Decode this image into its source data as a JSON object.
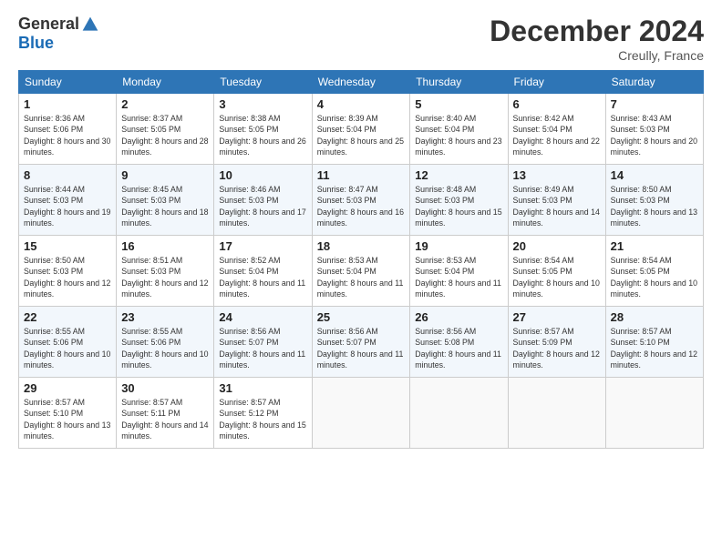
{
  "logo": {
    "general": "General",
    "blue": "Blue"
  },
  "title": "December 2024",
  "location": "Creully, France",
  "weekdays": [
    "Sunday",
    "Monday",
    "Tuesday",
    "Wednesday",
    "Thursday",
    "Friday",
    "Saturday"
  ],
  "weeks": [
    [
      {
        "day": "1",
        "sunrise": "Sunrise: 8:36 AM",
        "sunset": "Sunset: 5:06 PM",
        "daylight": "Daylight: 8 hours and 30 minutes."
      },
      {
        "day": "2",
        "sunrise": "Sunrise: 8:37 AM",
        "sunset": "Sunset: 5:05 PM",
        "daylight": "Daylight: 8 hours and 28 minutes."
      },
      {
        "day": "3",
        "sunrise": "Sunrise: 8:38 AM",
        "sunset": "Sunset: 5:05 PM",
        "daylight": "Daylight: 8 hours and 26 minutes."
      },
      {
        "day": "4",
        "sunrise": "Sunrise: 8:39 AM",
        "sunset": "Sunset: 5:04 PM",
        "daylight": "Daylight: 8 hours and 25 minutes."
      },
      {
        "day": "5",
        "sunrise": "Sunrise: 8:40 AM",
        "sunset": "Sunset: 5:04 PM",
        "daylight": "Daylight: 8 hours and 23 minutes."
      },
      {
        "day": "6",
        "sunrise": "Sunrise: 8:42 AM",
        "sunset": "Sunset: 5:04 PM",
        "daylight": "Daylight: 8 hours and 22 minutes."
      },
      {
        "day": "7",
        "sunrise": "Sunrise: 8:43 AM",
        "sunset": "Sunset: 5:03 PM",
        "daylight": "Daylight: 8 hours and 20 minutes."
      }
    ],
    [
      {
        "day": "8",
        "sunrise": "Sunrise: 8:44 AM",
        "sunset": "Sunset: 5:03 PM",
        "daylight": "Daylight: 8 hours and 19 minutes."
      },
      {
        "day": "9",
        "sunrise": "Sunrise: 8:45 AM",
        "sunset": "Sunset: 5:03 PM",
        "daylight": "Daylight: 8 hours and 18 minutes."
      },
      {
        "day": "10",
        "sunrise": "Sunrise: 8:46 AM",
        "sunset": "Sunset: 5:03 PM",
        "daylight": "Daylight: 8 hours and 17 minutes."
      },
      {
        "day": "11",
        "sunrise": "Sunrise: 8:47 AM",
        "sunset": "Sunset: 5:03 PM",
        "daylight": "Daylight: 8 hours and 16 minutes."
      },
      {
        "day": "12",
        "sunrise": "Sunrise: 8:48 AM",
        "sunset": "Sunset: 5:03 PM",
        "daylight": "Daylight: 8 hours and 15 minutes."
      },
      {
        "day": "13",
        "sunrise": "Sunrise: 8:49 AM",
        "sunset": "Sunset: 5:03 PM",
        "daylight": "Daylight: 8 hours and 14 minutes."
      },
      {
        "day": "14",
        "sunrise": "Sunrise: 8:50 AM",
        "sunset": "Sunset: 5:03 PM",
        "daylight": "Daylight: 8 hours and 13 minutes."
      }
    ],
    [
      {
        "day": "15",
        "sunrise": "Sunrise: 8:50 AM",
        "sunset": "Sunset: 5:03 PM",
        "daylight": "Daylight: 8 hours and 12 minutes."
      },
      {
        "day": "16",
        "sunrise": "Sunrise: 8:51 AM",
        "sunset": "Sunset: 5:03 PM",
        "daylight": "Daylight: 8 hours and 12 minutes."
      },
      {
        "day": "17",
        "sunrise": "Sunrise: 8:52 AM",
        "sunset": "Sunset: 5:04 PM",
        "daylight": "Daylight: 8 hours and 11 minutes."
      },
      {
        "day": "18",
        "sunrise": "Sunrise: 8:53 AM",
        "sunset": "Sunset: 5:04 PM",
        "daylight": "Daylight: 8 hours and 11 minutes."
      },
      {
        "day": "19",
        "sunrise": "Sunrise: 8:53 AM",
        "sunset": "Sunset: 5:04 PM",
        "daylight": "Daylight: 8 hours and 11 minutes."
      },
      {
        "day": "20",
        "sunrise": "Sunrise: 8:54 AM",
        "sunset": "Sunset: 5:05 PM",
        "daylight": "Daylight: 8 hours and 10 minutes."
      },
      {
        "day": "21",
        "sunrise": "Sunrise: 8:54 AM",
        "sunset": "Sunset: 5:05 PM",
        "daylight": "Daylight: 8 hours and 10 minutes."
      }
    ],
    [
      {
        "day": "22",
        "sunrise": "Sunrise: 8:55 AM",
        "sunset": "Sunset: 5:06 PM",
        "daylight": "Daylight: 8 hours and 10 minutes."
      },
      {
        "day": "23",
        "sunrise": "Sunrise: 8:55 AM",
        "sunset": "Sunset: 5:06 PM",
        "daylight": "Daylight: 8 hours and 10 minutes."
      },
      {
        "day": "24",
        "sunrise": "Sunrise: 8:56 AM",
        "sunset": "Sunset: 5:07 PM",
        "daylight": "Daylight: 8 hours and 11 minutes."
      },
      {
        "day": "25",
        "sunrise": "Sunrise: 8:56 AM",
        "sunset": "Sunset: 5:07 PM",
        "daylight": "Daylight: 8 hours and 11 minutes."
      },
      {
        "day": "26",
        "sunrise": "Sunrise: 8:56 AM",
        "sunset": "Sunset: 5:08 PM",
        "daylight": "Daylight: 8 hours and 11 minutes."
      },
      {
        "day": "27",
        "sunrise": "Sunrise: 8:57 AM",
        "sunset": "Sunset: 5:09 PM",
        "daylight": "Daylight: 8 hours and 12 minutes."
      },
      {
        "day": "28",
        "sunrise": "Sunrise: 8:57 AM",
        "sunset": "Sunset: 5:10 PM",
        "daylight": "Daylight: 8 hours and 12 minutes."
      }
    ],
    [
      {
        "day": "29",
        "sunrise": "Sunrise: 8:57 AM",
        "sunset": "Sunset: 5:10 PM",
        "daylight": "Daylight: 8 hours and 13 minutes."
      },
      {
        "day": "30",
        "sunrise": "Sunrise: 8:57 AM",
        "sunset": "Sunset: 5:11 PM",
        "daylight": "Daylight: 8 hours and 14 minutes."
      },
      {
        "day": "31",
        "sunrise": "Sunrise: 8:57 AM",
        "sunset": "Sunset: 5:12 PM",
        "daylight": "Daylight: 8 hours and 15 minutes."
      },
      null,
      null,
      null,
      null
    ]
  ]
}
